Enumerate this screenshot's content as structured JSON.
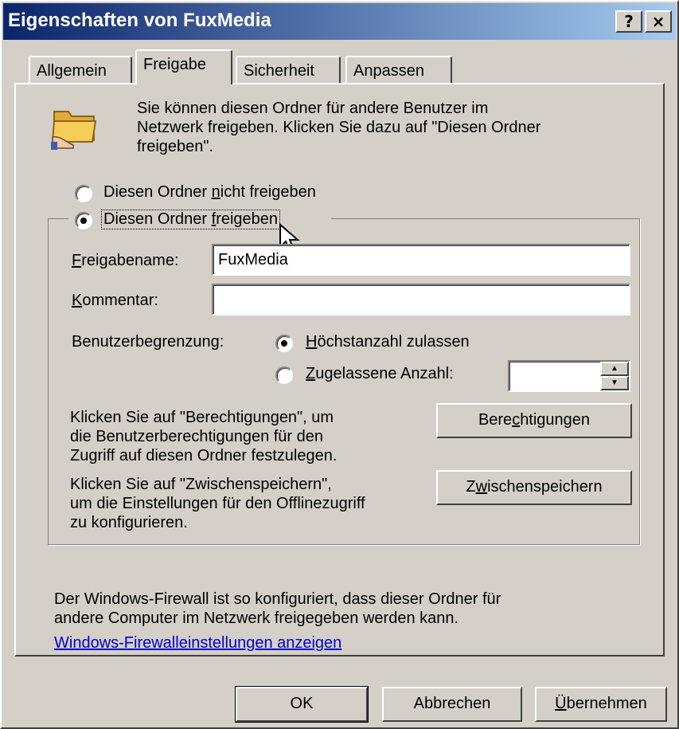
{
  "window": {
    "title": "Eigenschaften von FuxMedia",
    "help_label": "?",
    "close_label": "×"
  },
  "tabs": [
    {
      "label": "Allgemein"
    },
    {
      "label": "Freigabe"
    },
    {
      "label": "Sicherheit"
    },
    {
      "label": "Anpassen"
    }
  ],
  "info": {
    "line1": "Sie können diesen Ordner für andere Benutzer im",
    "line2": "Netzwerk freigeben. Klicken Sie dazu auf \"Diesen Ordner",
    "line3": "freigeben\"."
  },
  "radio_share": {
    "no": {
      "pre": "Diesen Ordner ",
      "acc": "n",
      "post": "icht freigeben",
      "selected": false
    },
    "yes": {
      "pre": "Diesen Ordner ",
      "acc": "f",
      "post": "reigeben",
      "selected": true
    }
  },
  "share_name": {
    "acc": "F",
    "post": "reigabename:",
    "value": "FuxMedia"
  },
  "comment": {
    "acc": "K",
    "post": "ommentar:",
    "value": ""
  },
  "user_limit": {
    "label": "Benutzerbegrenzung:",
    "max": {
      "acc": "H",
      "post": "öchstanzahl zulassen",
      "selected": true
    },
    "allowed": {
      "acc": "Z",
      "post": "ugelassene Anzahl:",
      "selected": false,
      "value": ""
    }
  },
  "permissions": {
    "line1": "Klicken Sie auf \"Berechtigungen\", um",
    "line2": "die Benutzerberechtigungen für den",
    "line3": "Zugriff auf diesen Ordner festzulegen.",
    "btn_pre": "Bere",
    "btn_acc": "c",
    "btn_post": "htigungen"
  },
  "caching": {
    "line1": "Klicken Sie auf \"Zwischenspeichern\",",
    "line2": "um die Einstellungen für den Offlinezugriff",
    "line3": "zu konfigurieren.",
    "btn_pre": "Z",
    "btn_acc": "w",
    "btn_post": "ischenspeichern"
  },
  "firewall": {
    "line1": "Der Windows-Firewall ist so konfiguriert, dass dieser Ordner für",
    "line2": "andere Computer im Netzwerk freigegeben werden kann.",
    "link": "Windows-Firewalleinstellungen anzeigen"
  },
  "buttons": {
    "ok": "OK",
    "cancel": "Abbrechen",
    "apply_acc": "Ü",
    "apply_post": "bernehmen"
  },
  "colors": {
    "face": "#d4d0c8",
    "title_start": "#0a246a",
    "title_end": "#a6caf0",
    "link": "#0000cc",
    "folder": "#f5c04a"
  }
}
